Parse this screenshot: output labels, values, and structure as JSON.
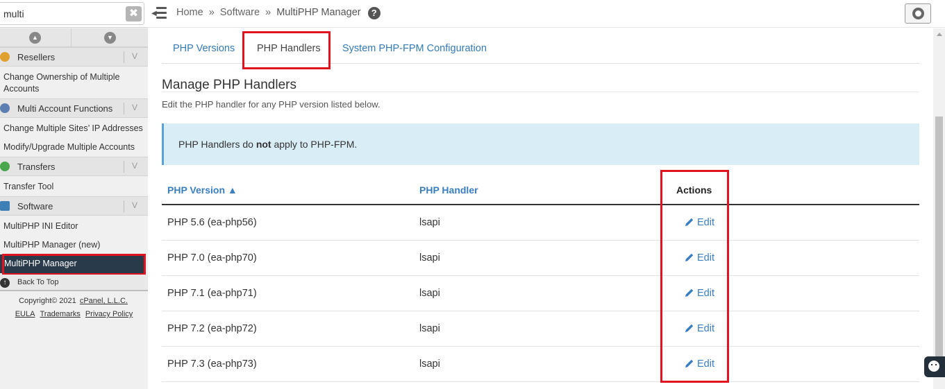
{
  "search": {
    "value": "multi",
    "clear_glyph": "✖"
  },
  "sidebar": {
    "groups": [
      {
        "label": "Resellers",
        "icon": "resellers-icon",
        "color": "#e0a030"
      },
      {
        "label": "Multi Account Functions",
        "icon": "multi-account-icon",
        "color": "#5b7fb0"
      },
      {
        "label": "Transfers",
        "icon": "transfers-icon",
        "color": "#4aa64a"
      },
      {
        "label": "Software",
        "icon": "software-icon",
        "color": "#3e7fb5"
      }
    ],
    "links": {
      "change_ownership": "Change Ownership of Multiple Accounts",
      "change_ip": "Change Multiple Sites’ IP Addresses",
      "modify_upgrade": "Modify/Upgrade Multiple Accounts",
      "transfer_tool": "Transfer Tool",
      "ini_editor": "MultiPHP INI Editor",
      "manager_new": "MultiPHP Manager (new)",
      "manager_active": "MultiPHP Manager"
    },
    "back_to_top": "Back To Top",
    "copyright_prefix": "Copyright© 2021",
    "copyright_company": "cPanel, L.L.C.",
    "footer_links": [
      "EULA",
      "Trademarks",
      "Privacy Policy"
    ]
  },
  "topbar": {
    "breadcrumbs": [
      "Home",
      "Software",
      "MultiPHP Manager"
    ],
    "separator": "»",
    "help_glyph": "?"
  },
  "tabs": [
    {
      "label": "PHP Versions",
      "active": false
    },
    {
      "label": "PHP Handlers",
      "active": true
    },
    {
      "label": "System PHP-FPM Configuration",
      "active": false
    }
  ],
  "main": {
    "title": "Manage PHP Handlers",
    "description": "Edit the PHP handler for any PHP version listed below.",
    "alert_before": "PHP Handlers do ",
    "alert_bold": "not",
    "alert_after": " apply to PHP-FPM."
  },
  "table": {
    "headers": {
      "version": "PHP Version ▲",
      "handler": "PHP Handler",
      "actions": "Actions"
    },
    "rows": [
      {
        "version": "PHP 5.6 (ea-php56)",
        "handler": "lsapi",
        "action": "Edit"
      },
      {
        "version": "PHP 7.0 (ea-php70)",
        "handler": "lsapi",
        "action": "Edit"
      },
      {
        "version": "PHP 7.1 (ea-php71)",
        "handler": "lsapi",
        "action": "Edit"
      },
      {
        "version": "PHP 7.2 (ea-php72)",
        "handler": "lsapi",
        "action": "Edit"
      },
      {
        "version": "PHP 7.3 (ea-php73)",
        "handler": "lsapi",
        "action": "Edit"
      }
    ]
  },
  "colors": {
    "accent": "#337ab7",
    "active_nav": "#293a4a",
    "alert_bg": "#d9edf7",
    "highlight": "#e0141e"
  }
}
